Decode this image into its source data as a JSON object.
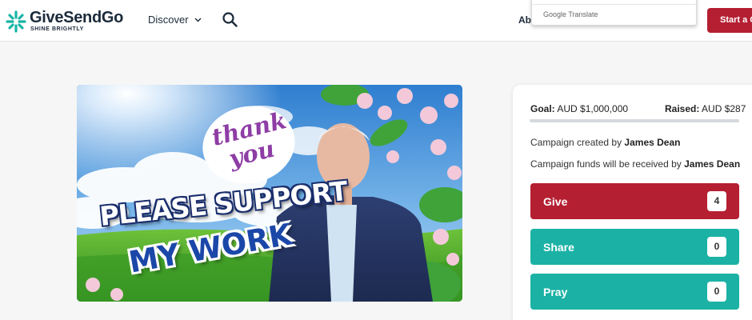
{
  "header": {
    "brand_name": "GiveSendGo",
    "brand_tagline": "SHINE BRIGHTLY",
    "nav_discover": "Discover",
    "nav_about": "Abo",
    "translate_label": "Google Translate",
    "start_button": "Start a C"
  },
  "hero": {
    "thank_text": "thank",
    "you_text": "you",
    "please_text": "PLEASE SUPPORT",
    "mywork_text": "MY WORK"
  },
  "campaign": {
    "goal_label": "Goal:",
    "goal_value": "AUD $1,000,000",
    "raised_label": "Raised:",
    "raised_value": "AUD $287",
    "progress_fraction": 0.000287,
    "created_prefix": "Campaign created by",
    "creator": "James Dean",
    "received_prefix": "Campaign funds will be received by",
    "recipient": "James Dean"
  },
  "actions": {
    "give_label": "Give",
    "give_count": "4",
    "share_label": "Share",
    "share_count": "0",
    "pray_label": "Pray",
    "pray_count": "0"
  },
  "colors": {
    "brand_teal": "#1bb2a5",
    "brand_red": "#b51f32",
    "brand_navy": "#1b2a3a"
  },
  "icons": [
    "givesendgo-logo-icon",
    "chevron-down-icon",
    "search-icon"
  ]
}
